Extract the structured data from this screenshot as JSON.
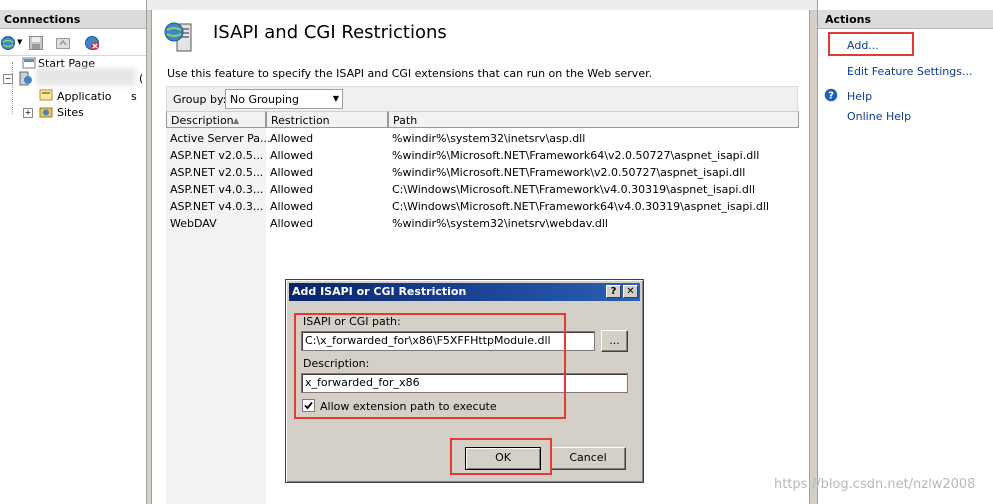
{
  "connections": {
    "title": "Connections",
    "tree": {
      "start_page": "Start Page",
      "server_suffix": "(",
      "app_pools": "Applicatio",
      "app_pools_tail": "s",
      "sites": "Sites"
    }
  },
  "feature": {
    "title": "ISAPI and CGI Restrictions",
    "description": "Use this feature to specify the ISAPI and CGI extensions that can run on the Web server.",
    "group_by_label": "Group by:",
    "group_by_value": "No Grouping",
    "columns": [
      "Description",
      "Restriction",
      "Path"
    ],
    "rows": [
      {
        "description": "Active Server Pa...",
        "restriction": "Allowed",
        "path": "%windir%\\system32\\inetsrv\\asp.dll"
      },
      {
        "description": "ASP.NET v2.0.5...",
        "restriction": "Allowed",
        "path": "%windir%\\Microsoft.NET\\Framework64\\v2.0.50727\\aspnet_isapi.dll"
      },
      {
        "description": "ASP.NET v2.0.5...",
        "restriction": "Allowed",
        "path": "%windir%\\Microsoft.NET\\Framework\\v2.0.50727\\aspnet_isapi.dll"
      },
      {
        "description": "ASP.NET v4.0.3...",
        "restriction": "Allowed",
        "path": "C:\\Windows\\Microsoft.NET\\Framework\\v4.0.30319\\aspnet_isapi.dll"
      },
      {
        "description": "ASP.NET v4.0.3...",
        "restriction": "Allowed",
        "path": "C:\\Windows\\Microsoft.NET\\Framework64\\v4.0.30319\\aspnet_isapi.dll"
      },
      {
        "description": "WebDAV",
        "restriction": "Allowed",
        "path": "%windir%\\system32\\inetsrv\\webdav.dll"
      }
    ]
  },
  "actions": {
    "title": "Actions",
    "add": "Add...",
    "edit_settings": "Edit Feature Settings...",
    "help": "Help",
    "online_help": "Online Help"
  },
  "dialog": {
    "title": "Add ISAPI or CGI Restriction",
    "help_btn": "?",
    "close_btn": "✕",
    "path_label": "ISAPI or CGI path:",
    "path_value": "C:\\x_forwarded_for\\x86\\F5XFFHttpModule.dll",
    "browse_label": "...",
    "desc_label": "Description:",
    "desc_value": "x_forwarded_for_x86",
    "checkbox_label": "Allow extension path to execute",
    "checkbox_checked": true,
    "ok_label": "OK",
    "cancel_label": "Cancel"
  },
  "watermark": "https://blog.csdn.net/nzlw2008",
  "colors": {
    "highlight_box": "#e53935",
    "link": "#0a3d8c",
    "title_bar": "#0a246a"
  }
}
